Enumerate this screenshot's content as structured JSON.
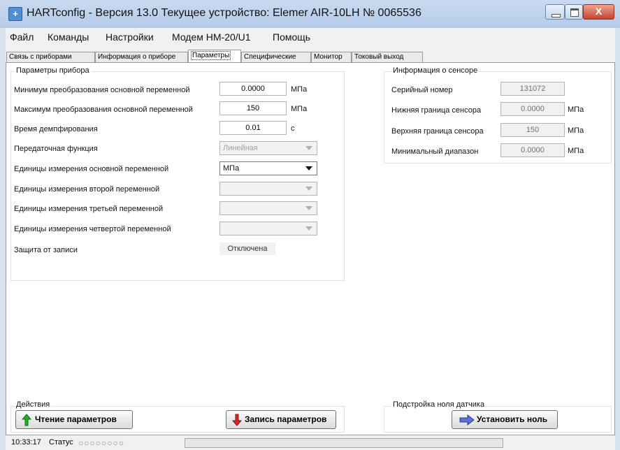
{
  "window": {
    "title": "HARTconfig - Версия 13.0 Текущее устройство: Elemer AIR-10LH № 0065536",
    "icon_name": "app-plus-icon",
    "close_glyph": "X"
  },
  "menu": [
    "Файл",
    "Команды",
    "Настройки",
    "Модем HM-20/U1",
    "Помощь"
  ],
  "tabs": [
    {
      "label": "Связь с приборами"
    },
    {
      "label": "Информация о приборе"
    },
    {
      "label": "Параметры",
      "active": true
    },
    {
      "label": "Специфические"
    },
    {
      "label": "Монитор"
    },
    {
      "label": "Токовый выход"
    }
  ],
  "params": {
    "group_title": "Параметры прибора",
    "rows": [
      {
        "label": "Минимум преобразования основной переменной",
        "value": "0.0000",
        "unit": "МПа"
      },
      {
        "label": "Максимум преобразования основной переменной",
        "value": "150",
        "unit": "МПа"
      },
      {
        "label": "Время демпфирования",
        "value": "0.01",
        "unit": "с"
      }
    ],
    "combos": [
      {
        "label": "Передаточная функция",
        "value": "Линейная",
        "enabled": false
      },
      {
        "label": "Единицы измерения основной переменной",
        "value": "МПа",
        "enabled": true
      },
      {
        "label": "Единицы измерения второй переменной",
        "value": "",
        "enabled": false
      },
      {
        "label": "Единицы измерения третьей переменной",
        "value": "",
        "enabled": false
      },
      {
        "label": "Единицы измерения четвертой переменной",
        "value": "",
        "enabled": false
      }
    ],
    "write_protect": {
      "label": "Защита от записи",
      "value": "Отключена"
    }
  },
  "sensor": {
    "group_title": "Информация о сенсоре",
    "rows": [
      {
        "label": "Серийный номер",
        "value": "131072",
        "unit": ""
      },
      {
        "label": "Нижняя граница сенсора",
        "value": "0.0000",
        "unit": "МПа"
      },
      {
        "label": "Верхняя граница сенсора",
        "value": "150",
        "unit": "МПа"
      },
      {
        "label": "Минимальный диапазон",
        "value": "0.0000",
        "unit": "МПа"
      }
    ]
  },
  "actions": {
    "group_title": "Действия",
    "read_label": "Чтение параметров",
    "write_label": "Запись параметров"
  },
  "zero": {
    "group_title": "Подстройка ноля датчика",
    "button_label": "Установить ноль"
  },
  "status": {
    "time": "10:33:17",
    "label": "Статус",
    "dots": "○○○○○○○○"
  }
}
